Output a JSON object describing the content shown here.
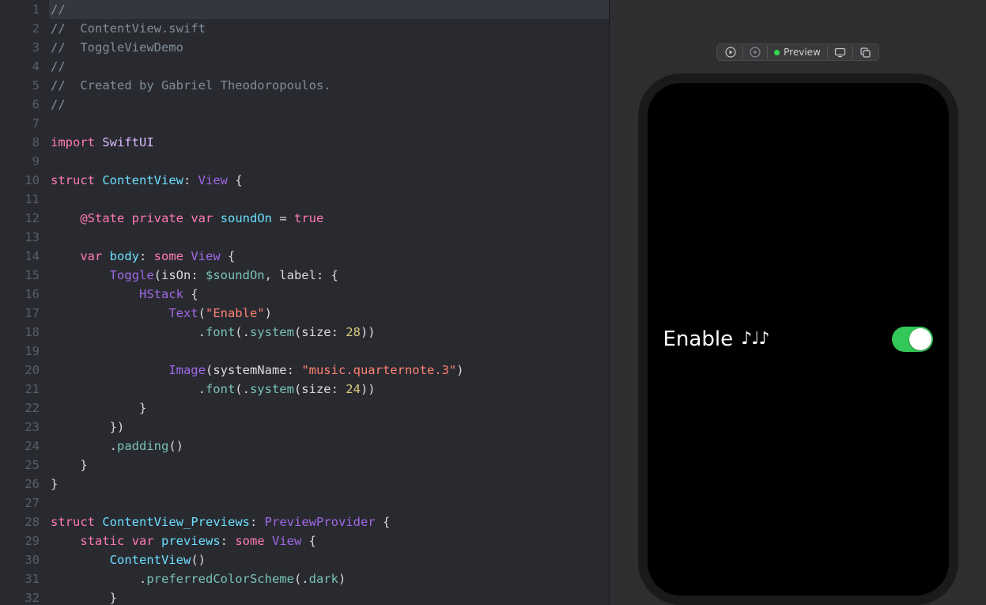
{
  "editor": {
    "lines": [
      [
        [
          "c",
          "//"
        ]
      ],
      [
        [
          "c",
          "//  ContentView.swift"
        ]
      ],
      [
        [
          "c",
          "//  ToggleViewDemo"
        ]
      ],
      [
        [
          "c",
          "//"
        ]
      ],
      [
        [
          "c",
          "//  Created by Gabriel Theodoropoulos."
        ]
      ],
      [
        [
          "c",
          "//"
        ]
      ],
      [],
      [
        [
          "kw",
          "import"
        ],
        [
          "p",
          " "
        ],
        [
          "ty",
          "SwiftUI"
        ]
      ],
      [],
      [
        [
          "kw",
          "struct"
        ],
        [
          "p",
          " "
        ],
        [
          "decl",
          "ContentView"
        ],
        [
          "p",
          ": "
        ],
        [
          "fn",
          "View"
        ],
        [
          "p",
          " {"
        ]
      ],
      [],
      [
        [
          "p",
          "    "
        ],
        [
          "at",
          "@State"
        ],
        [
          "p",
          " "
        ],
        [
          "kw",
          "private"
        ],
        [
          "p",
          " "
        ],
        [
          "kw",
          "var"
        ],
        [
          "p",
          " "
        ],
        [
          "decl",
          "soundOn"
        ],
        [
          "p",
          " = "
        ],
        [
          "kw",
          "true"
        ]
      ],
      [],
      [
        [
          "p",
          "    "
        ],
        [
          "kw",
          "var"
        ],
        [
          "p",
          " "
        ],
        [
          "decl",
          "body"
        ],
        [
          "p",
          ": "
        ],
        [
          "kw",
          "some"
        ],
        [
          "p",
          " "
        ],
        [
          "fn",
          "View"
        ],
        [
          "p",
          " {"
        ]
      ],
      [
        [
          "p",
          "        "
        ],
        [
          "fn",
          "Toggle"
        ],
        [
          "p",
          "(isOn: "
        ],
        [
          "prop",
          "$soundOn"
        ],
        [
          "p",
          ", label: {"
        ]
      ],
      [
        [
          "p",
          "            "
        ],
        [
          "fn",
          "HStack"
        ],
        [
          "p",
          " {"
        ]
      ],
      [
        [
          "p",
          "                "
        ],
        [
          "fn",
          "Text"
        ],
        [
          "p",
          "("
        ],
        [
          "str",
          "\"Enable\""
        ],
        [
          "p",
          ")"
        ]
      ],
      [
        [
          "p",
          "                    ."
        ],
        [
          "mem",
          "font"
        ],
        [
          "p",
          "(."
        ],
        [
          "mem",
          "system"
        ],
        [
          "p",
          "(size: "
        ],
        [
          "num",
          "28"
        ],
        [
          "p",
          "))"
        ]
      ],
      [],
      [
        [
          "p",
          "                "
        ],
        [
          "fn",
          "Image"
        ],
        [
          "p",
          "(systemName: "
        ],
        [
          "str",
          "\"music.quarternote.3\""
        ],
        [
          "p",
          ")"
        ]
      ],
      [
        [
          "p",
          "                    ."
        ],
        [
          "mem",
          "font"
        ],
        [
          "p",
          "(."
        ],
        [
          "mem",
          "system"
        ],
        [
          "p",
          "(size: "
        ],
        [
          "num",
          "24"
        ],
        [
          "p",
          "))"
        ]
      ],
      [
        [
          "p",
          "            }"
        ]
      ],
      [
        [
          "p",
          "        })"
        ]
      ],
      [
        [
          "p",
          "        ."
        ],
        [
          "mem",
          "padding"
        ],
        [
          "p",
          "()"
        ]
      ],
      [
        [
          "p",
          "    }"
        ]
      ],
      [
        [
          "p",
          "}"
        ]
      ],
      [],
      [
        [
          "kw",
          "struct"
        ],
        [
          "p",
          " "
        ],
        [
          "decl",
          "ContentView_Previews"
        ],
        [
          "p",
          ": "
        ],
        [
          "fn",
          "PreviewProvider"
        ],
        [
          "p",
          " {"
        ]
      ],
      [
        [
          "p",
          "    "
        ],
        [
          "kw",
          "static"
        ],
        [
          "p",
          " "
        ],
        [
          "kw",
          "var"
        ],
        [
          "p",
          " "
        ],
        [
          "decl",
          "previews"
        ],
        [
          "p",
          ": "
        ],
        [
          "kw",
          "some"
        ],
        [
          "p",
          " "
        ],
        [
          "fn",
          "View"
        ],
        [
          "p",
          " {"
        ]
      ],
      [
        [
          "p",
          "        "
        ],
        [
          "decl",
          "ContentView"
        ],
        [
          "p",
          "()"
        ]
      ],
      [
        [
          "p",
          "            ."
        ],
        [
          "mem",
          "preferredColorScheme"
        ],
        [
          "p",
          "(."
        ],
        [
          "mem",
          "dark"
        ],
        [
          "p",
          ")"
        ]
      ],
      [
        [
          "p",
          "        }"
        ]
      ]
    ],
    "first_line_no": 1,
    "highlighted_line": 1
  },
  "toolbar": {
    "preview_label": "Preview"
  },
  "preview": {
    "toggle_label": "Enable",
    "toggle_icon": "♪♩♪",
    "toggle_on": true
  }
}
